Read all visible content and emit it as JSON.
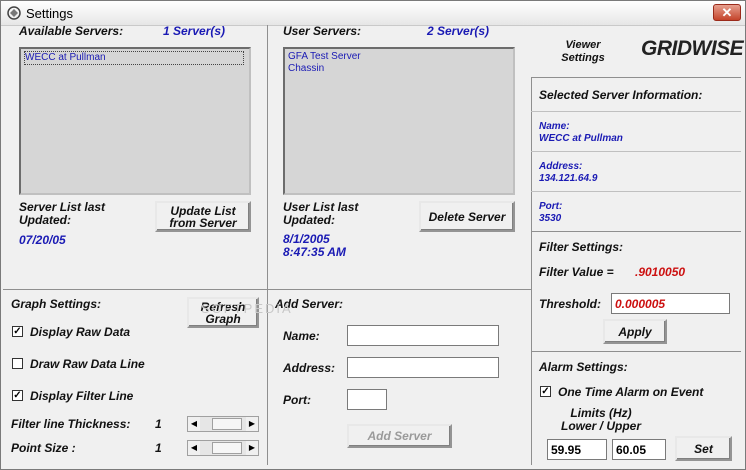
{
  "window": {
    "title": "Settings",
    "close_glyph": "✕"
  },
  "available": {
    "label": "Available Servers:",
    "count": "1 Server(s)",
    "servers": [
      "WECC at Pullman"
    ],
    "last_updated_label": "Server List last Updated:",
    "last_updated_value": "07/20/05",
    "update_button": "Update List from Server"
  },
  "user": {
    "label": "User Servers:",
    "count": "2 Server(s)",
    "servers": [
      "GFA Test Server",
      "Chassin"
    ],
    "last_updated_label": "User List last Updated:",
    "last_updated_value": "8/1/2005 8:47:35 AM",
    "delete_button": "Delete Server"
  },
  "viewer": {
    "label": "Viewer Settings",
    "logo_text": "GRIDWISE"
  },
  "selected": {
    "title": "Selected Server Information:",
    "name_label": "Name:",
    "name_value": "WECC at Pullman",
    "address_label": "Address:",
    "address_value": "134.121.64.9",
    "port_label": "Port:",
    "port_value": "3530"
  },
  "filter": {
    "title": "Filter Settings:",
    "value_label": "Filter Value =",
    "value": ".9010050",
    "threshold_label": "Threshold:",
    "threshold_value": "0.000005",
    "apply_button": "Apply"
  },
  "graph": {
    "title": "Graph Settings:",
    "refresh_button": "Refresh Graph",
    "display_raw": "Display Raw Data",
    "display_raw_checked": true,
    "draw_raw_line": "Draw Raw Data Line",
    "draw_raw_line_checked": false,
    "display_filter": "Display Filter Line",
    "display_filter_checked": true,
    "thickness_label": "Filter line Thickness:",
    "thickness_value": "1",
    "point_size_label": "Point Size :",
    "point_size_value": "1"
  },
  "add_server": {
    "title": "Add Server:",
    "name_label": "Name:",
    "address_label": "Address:",
    "port_label": "Port:",
    "name_value": "",
    "address_value": "",
    "port_value": "",
    "button": "Add Server"
  },
  "alarm": {
    "title": "Alarm Settings:",
    "one_time": "One Time Alarm on Event",
    "one_time_checked": true,
    "limits_label": "Limits (Hz) Lower / Upper",
    "lower": "59.95",
    "upper": "60.05",
    "set_button": "Set"
  },
  "watermark": "SOFTPEDIA",
  "colors": {
    "accent_blue": "#1a1ab4",
    "value_red": "#cc1010"
  }
}
